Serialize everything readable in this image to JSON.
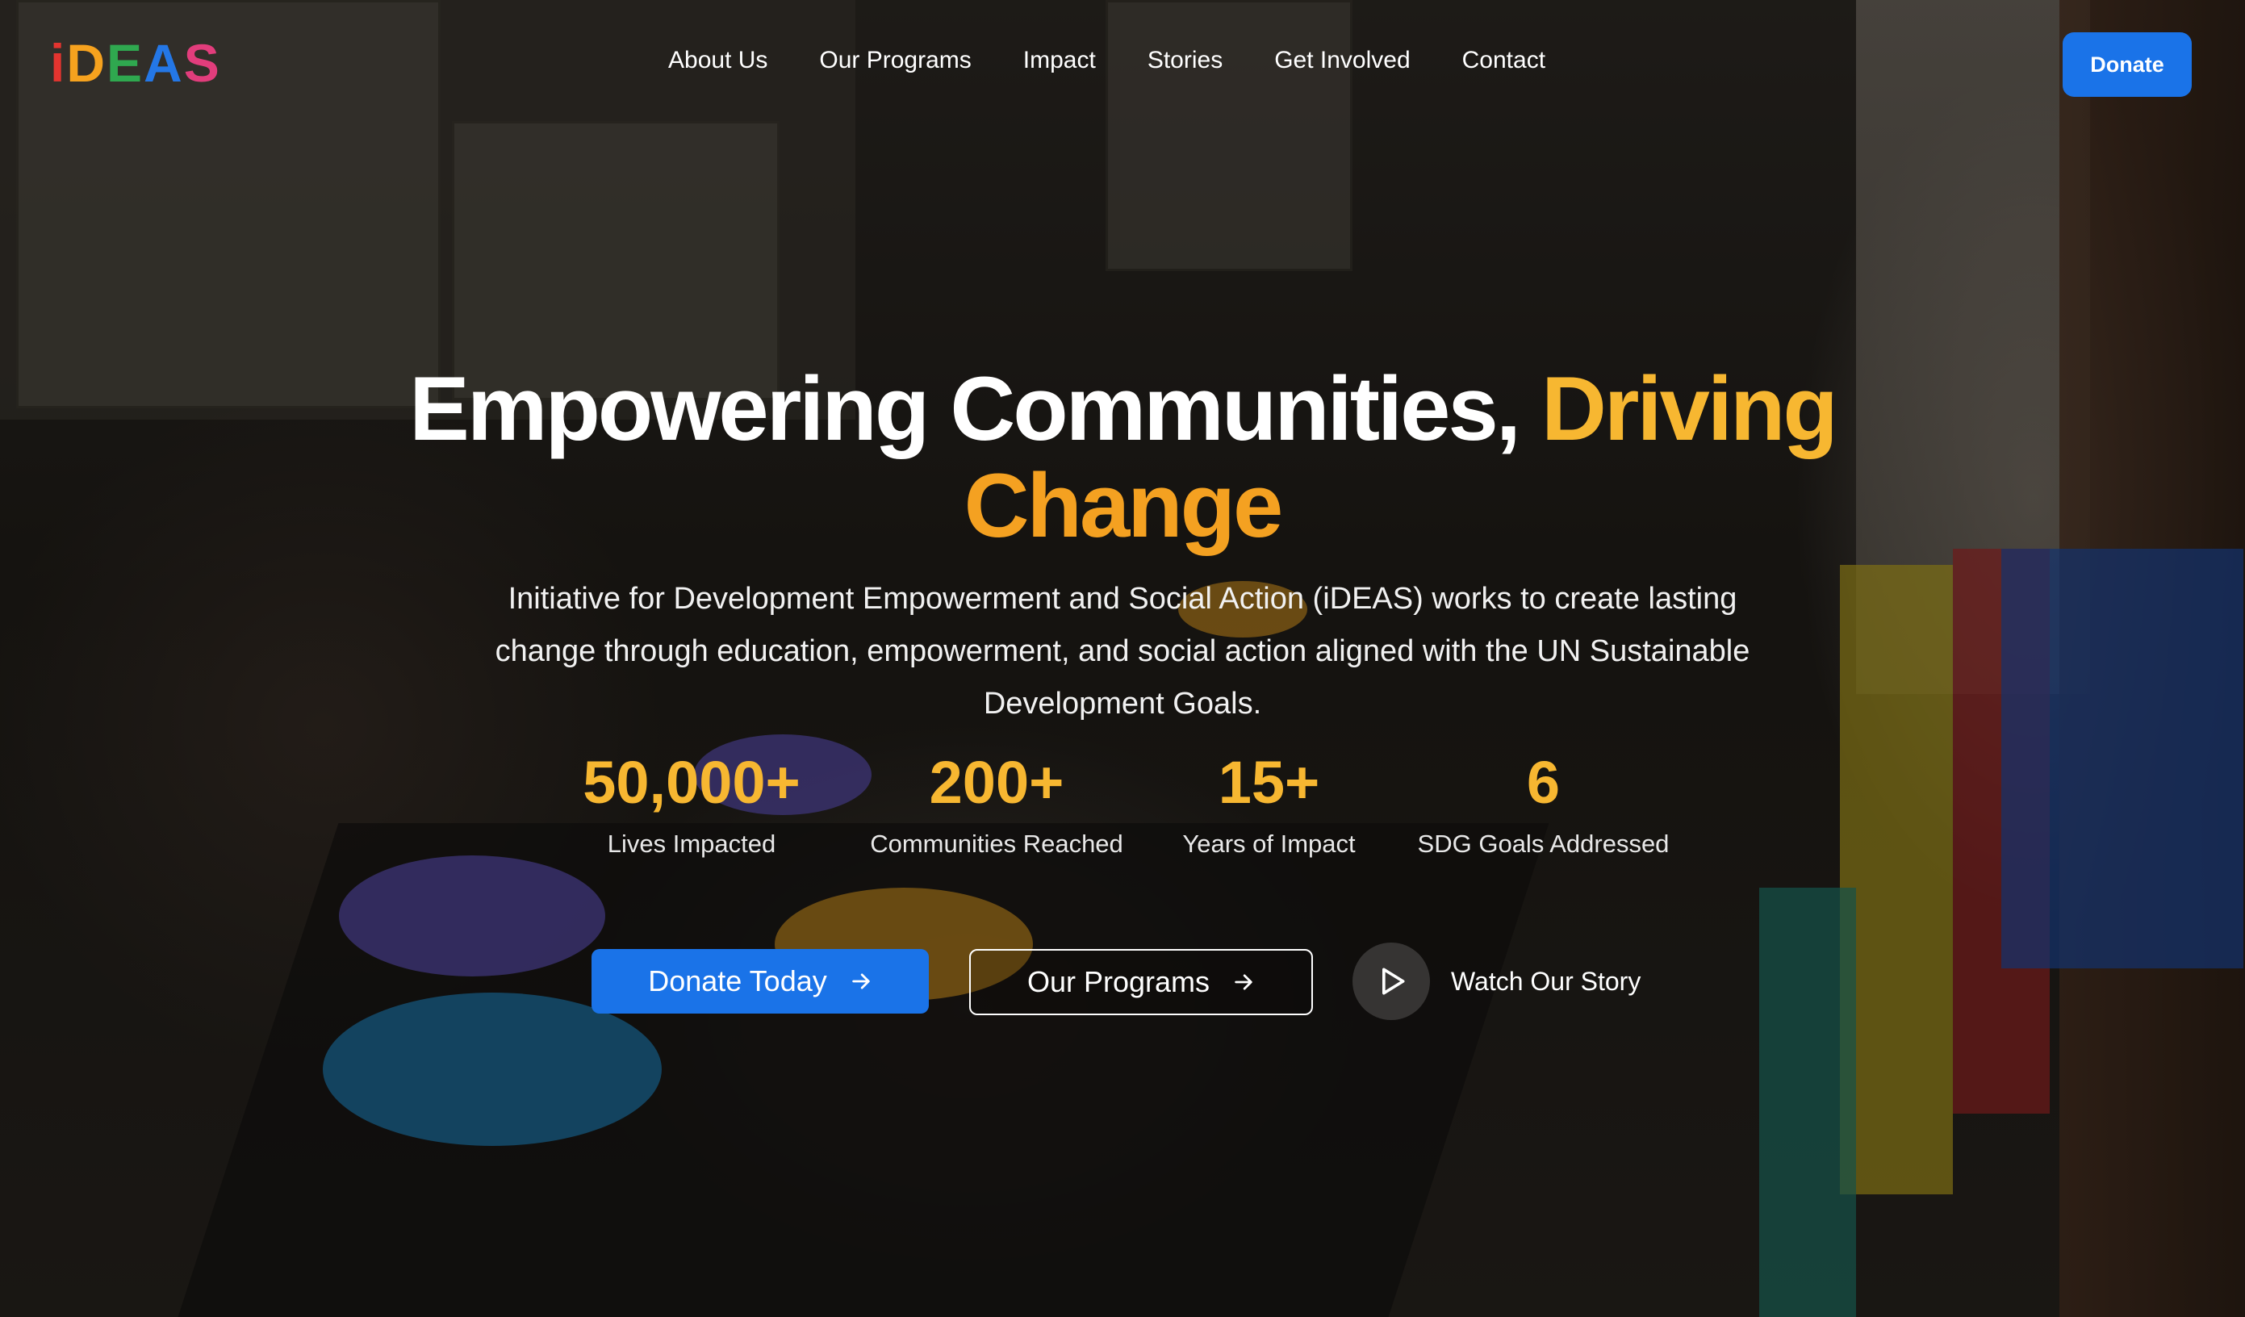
{
  "brand": {
    "logo_letters": [
      {
        "char": "i",
        "color": "#e3342f"
      },
      {
        "char": "D",
        "color": "#f6a21e"
      },
      {
        "char": "E",
        "color": "#2fa84f"
      },
      {
        "char": "A",
        "color": "#2477e6"
      },
      {
        "char": "S",
        "color": "#e23d7c"
      }
    ]
  },
  "nav": {
    "links": [
      "About Us",
      "Our Programs",
      "Impact",
      "Stories",
      "Get Involved",
      "Contact"
    ],
    "donate_label": "Donate"
  },
  "hero": {
    "headline_part1": "Empowering Communities, ",
    "headline_accent1": "Driving",
    "headline_accent2": "Change",
    "subtitle": "Initiative for Development Empowerment and Social Action (iDEAS) works to create lasting change through education, empowerment, and social action aligned with the UN Sustainable Development Goals."
  },
  "stats": [
    {
      "value": "50,000+",
      "label": "Lives Impacted"
    },
    {
      "value": "200+",
      "label": "Communities Reached"
    },
    {
      "value": "15+",
      "label": "Years of Impact"
    },
    {
      "value": "6",
      "label": "SDG Goals Addressed"
    }
  ],
  "actions": {
    "donate_today": "Donate Today",
    "our_programs": "Our Programs",
    "watch_story": "Watch Our Story"
  },
  "colors": {
    "primary": "#1a73e8",
    "accent": "#f7b731"
  }
}
